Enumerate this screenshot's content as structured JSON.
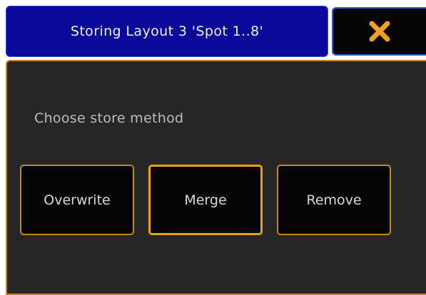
{
  "dialog": {
    "title": "Storing Layout 3 'Spot 1..8'",
    "close_icon": "close-x-icon",
    "prompt": "Choose store method",
    "methods": [
      {
        "label": "Overwrite",
        "selected": false
      },
      {
        "label": "Merge",
        "selected": true
      },
      {
        "label": "Remove",
        "selected": false
      }
    ]
  },
  "colors": {
    "title_bar_bg": "#0a0a9a",
    "accent_border": "#c08a1e",
    "selected_border": "#e8a018",
    "close_icon": "#f0a020",
    "panel_bg": "#262626",
    "button_bg": "#050505"
  }
}
